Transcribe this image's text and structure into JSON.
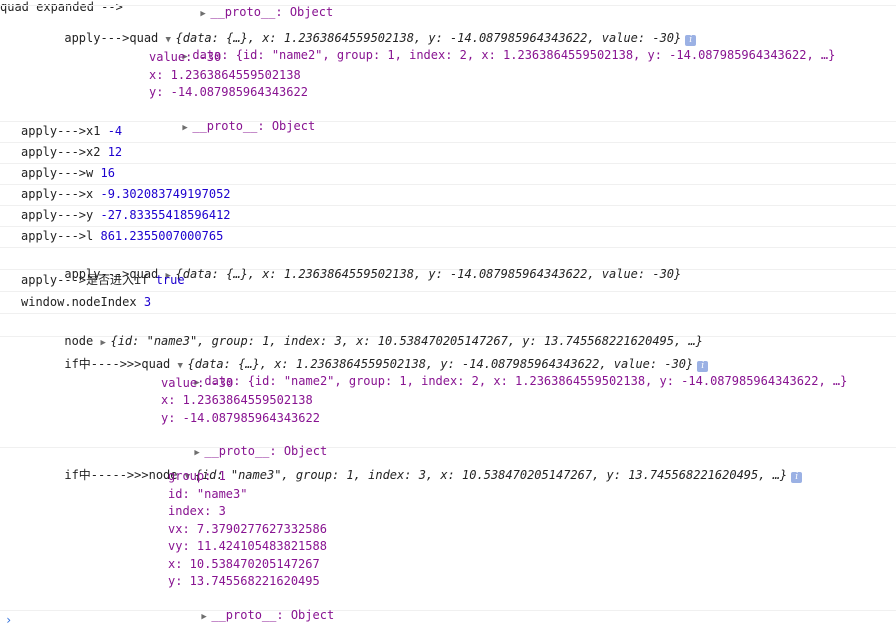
{
  "rows": {
    "r0": {
      "tail": "__proto__: Object"
    },
    "r1": {
      "label": "apply--->quad ",
      "summary": "{data: {…}, x: 1.2363864559502138, y: -14.087985964343622, value: -30}",
      "data_line": "data: {id: \"name2\", group: 1, index: 2, x: 1.2363864559502138, y: -14.087985964343622, …}",
      "value_line": "value: -30",
      "x_line": "x: 1.2363864559502138",
      "y_line": "y: -14.087985964343622",
      "proto_line": "__proto__: Object"
    },
    "r2": {
      "label": "apply--->x1 ",
      "value": "-4"
    },
    "r3": {
      "label": "apply--->x2 ",
      "value": "12"
    },
    "r4": {
      "label": "apply--->w ",
      "value": "16"
    },
    "r5": {
      "label": "apply--->x ",
      "value": "-9.302083749197052"
    },
    "r6": {
      "label": "apply--->y ",
      "value": "-27.83355418596412"
    },
    "r7": {
      "label": "apply--->l ",
      "value": "861.2355007000765"
    },
    "r8": {
      "label": "apply--->quad ",
      "summary": "{data: {…}, x: 1.2363864559502138, y: -14.087985964343622, value: -30}"
    },
    "r9": {
      "label": "apply--->是否进入if ",
      "value": "true"
    },
    "r10": {
      "label": "window.nodeIndex ",
      "value": "3"
    },
    "r11": {
      "label": "node ",
      "summary": "{id: \"name3\", group: 1, index: 3, x: 10.538470205147267, y: 13.745568221620495, …}"
    },
    "r12": {
      "label": "if中---->>>quad ",
      "summary": "{data: {…}, x: 1.2363864559502138, y: -14.087985964343622, value: -30}",
      "data_line": "data: {id: \"name2\", group: 1, index: 2, x: 1.2363864559502138, y: -14.087985964343622, …}",
      "value_line": "value: -30",
      "x_line": "x: 1.2363864559502138",
      "y_line": "y: -14.087985964343622",
      "proto_line": "__proto__: Object"
    },
    "r13": {
      "label": "if中----->>>node ",
      "summary": "{id: \"name3\", group: 1, index: 3, x: 10.538470205147267, y: 13.745568221620495, …}",
      "group_line": "group: 1",
      "id_line": "id: \"name3\"",
      "index_line": "index: 3",
      "vx_line": "vx: 7.3790277627332586",
      "vy_line": "vy: 11.424105483821588",
      "x_line": "x: 10.538470205147267",
      "y_line": "y: 13.745568221620495",
      "proto_line": "__proto__: Object"
    }
  },
  "prompt": "›",
  "colors": {
    "number": "#1c00cf",
    "string": "#c41a16",
    "key": "#881391",
    "info_badge": "#9bb1e4"
  },
  "icons": {
    "expanded": "triangle-down",
    "collapsed": "triangle-right",
    "info": "info-icon"
  }
}
